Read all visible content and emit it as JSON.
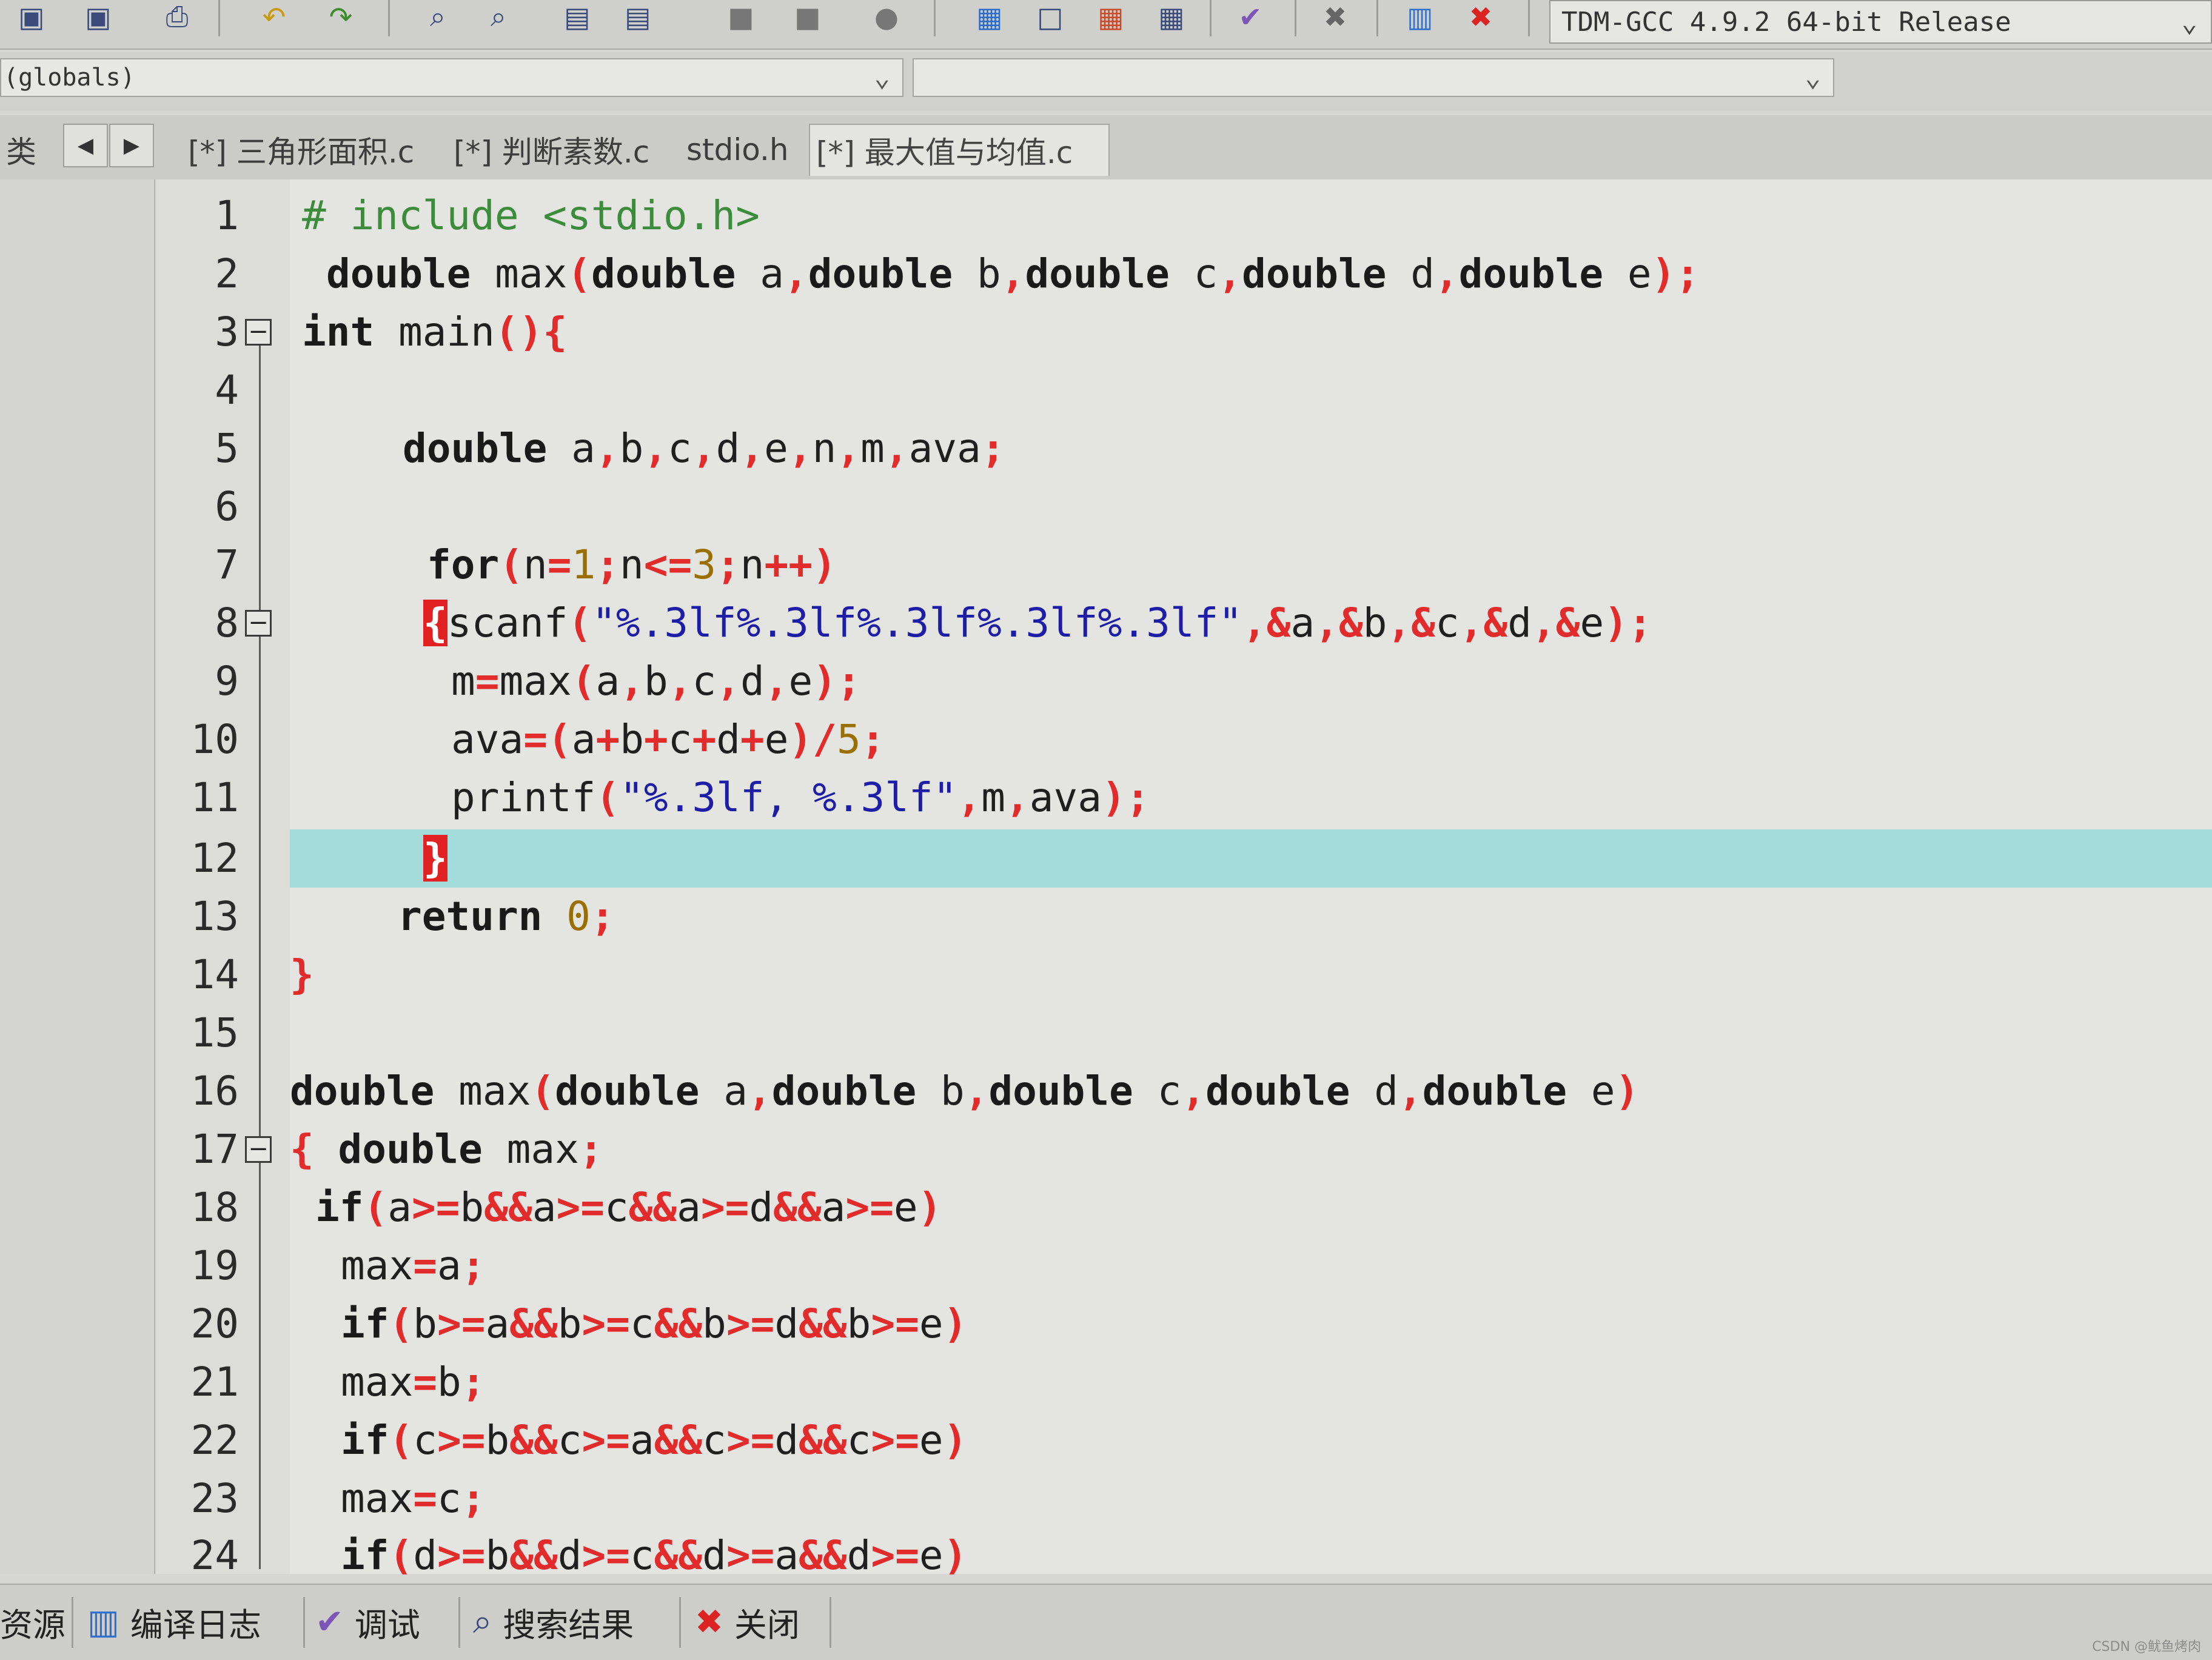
{
  "toolbar": {
    "compiler": "TDM-GCC 4.9.2 64-bit Release",
    "icons": [
      "debug-icon",
      "debug-all-icon",
      "print-icon",
      "undo-icon",
      "redo-icon",
      "find-icon",
      "replace-icon",
      "save-icon",
      "save-all-icon",
      "compile-icon",
      "run-icon",
      "stop-icon",
      "project-new-icon",
      "window-icon",
      "class-icon",
      "grid-icon",
      "check-icon",
      "close-icon",
      "chart-icon",
      "delete-icon"
    ]
  },
  "scope": {
    "left_value": "(globals)",
    "right_value": ""
  },
  "tabs": {
    "left_label": "类",
    "items": [
      {
        "label": "[*] 三角形面积.c",
        "active": false
      },
      {
        "label": "[*] 判断素数.c",
        "active": false
      },
      {
        "label": "stdio.h",
        "active": false
      },
      {
        "label": "[*] 最大值与均值.c",
        "active": true
      }
    ]
  },
  "editor": {
    "highlighted_line": 12,
    "lines": [
      {
        "n": "1"
      },
      {
        "n": "2"
      },
      {
        "n": "3"
      },
      {
        "n": "4"
      },
      {
        "n": "5"
      },
      {
        "n": "6"
      },
      {
        "n": "7"
      },
      {
        "n": "8"
      },
      {
        "n": "9"
      },
      {
        "n": "10"
      },
      {
        "n": "11"
      },
      {
        "n": "12"
      },
      {
        "n": "13"
      },
      {
        "n": "14"
      },
      {
        "n": "15"
      },
      {
        "n": "16"
      },
      {
        "n": "17"
      },
      {
        "n": "18"
      },
      {
        "n": "19"
      },
      {
        "n": "20"
      },
      {
        "n": "21"
      },
      {
        "n": "22"
      },
      {
        "n": "23"
      },
      {
        "n": "24"
      }
    ],
    "code": {
      "l1_pre": "# include <stdio.h>",
      "l2_t1": "double",
      "l2_t2": " max",
      "l2_t3": "(",
      "l2_t4": "double",
      "l2_t5": " a",
      "l2_t6": ",",
      "l2_t7": "double",
      "l2_t8": " b",
      "l2_t9": ",",
      "l2_t10": "double",
      "l2_t11": " c",
      "l2_t12": ",",
      "l2_t13": "double",
      "l2_t14": " d",
      "l2_t15": ",",
      "l2_t16": "double",
      "l2_t17": " e",
      "l2_t18": ");",
      "l3_t1": "int",
      "l3_t2": " main",
      "l3_t3": "(){",
      "l5_t1": "double",
      "l5_t2": " a",
      "l5_t3": ",",
      "l5_t4": "b",
      "l5_t5": ",",
      "l5_t6": "c",
      "l5_t7": ",",
      "l5_t8": "d",
      "l5_t9": ",",
      "l5_t10": "e",
      "l5_t11": ",",
      "l5_t12": "n",
      "l5_t13": ",",
      "l5_t14": "m",
      "l5_t15": ",",
      "l5_t16": "ava",
      "l5_t17": ";",
      "l7_t1": "for",
      "l7_t2": "(",
      "l7_t3": "n",
      "l7_t4": "=",
      "l7_t5": "1",
      "l7_t6": ";",
      "l7_t7": "n",
      "l7_t8": "<=",
      "l7_t9": "3",
      "l7_t10": ";",
      "l7_t11": "n",
      "l7_t12": "++)",
      "l8_t1": "{",
      "l8_t2": "scanf",
      "l8_t3": "(",
      "l8_t4": "\"%.3lf%.3lf%.3lf%.3lf%.3lf\"",
      "l8_t5": ",&",
      "l8_t6": "a",
      "l8_t7": ",&",
      "l8_t8": "b",
      "l8_t9": ",&",
      "l8_t10": "c",
      "l8_t11": ",&",
      "l8_t12": "d",
      "l8_t13": ",&",
      "l8_t14": "e",
      "l8_t15": ");",
      "l9_t1": "m",
      "l9_t2": "=",
      "l9_t3": "max",
      "l9_t4": "(",
      "l9_t5": "a",
      "l9_t6": ",",
      "l9_t7": "b",
      "l9_t8": ",",
      "l9_t9": "c",
      "l9_t10": ",",
      "l9_t11": "d",
      "l9_t12": ",",
      "l9_t13": "e",
      "l9_t14": ");",
      "l10_t1": "ava",
      "l10_t2": "=(",
      "l10_t3": "a",
      "l10_t4": "+",
      "l10_t5": "b",
      "l10_t6": "+",
      "l10_t7": "c",
      "l10_t8": "+",
      "l10_t9": "d",
      "l10_t10": "+",
      "l10_t11": "e",
      "l10_t12": ")/",
      "l10_t13": "5",
      "l10_t14": ";",
      "l11_t1": "printf",
      "l11_t2": "(",
      "l11_t3": "\"%.3lf, %.3lf\"",
      "l11_t4": ",",
      "l11_t5": "m",
      "l11_t6": ",",
      "l11_t7": "ava",
      "l11_t8": ");",
      "l12_t1": "}",
      "l13_t1": "return",
      "l13_t2": " 0",
      "l13_t3": ";",
      "l14_t1": "}",
      "l16_t1": "double",
      "l16_t2": " max",
      "l16_t3": "(",
      "l16_t4": "double",
      "l16_t5": " a",
      "l16_t6": ",",
      "l16_t7": "double",
      "l16_t8": " b",
      "l16_t9": ",",
      "l16_t10": "double",
      "l16_t11": " c",
      "l16_t12": ",",
      "l16_t13": "double",
      "l16_t14": " d",
      "l16_t15": ",",
      "l16_t16": "double",
      "l16_t17": " e",
      "l16_t18": ")",
      "l17_t1": "{",
      "l17_t2": " double",
      "l17_t3": " max",
      "l17_t4": ";",
      "l18_t1": "if",
      "l18_t2": "(",
      "l18_t3": "a",
      "l18_t4": ">=",
      "l18_t5": "b",
      "l18_t6": "&&",
      "l18_t7": "a",
      "l18_t8": ">=",
      "l18_t9": "c",
      "l18_t10": "&&",
      "l18_t11": "a",
      "l18_t12": ">=",
      "l18_t13": "d",
      "l18_t14": "&&",
      "l18_t15": "a",
      "l18_t16": ">=",
      "l18_t17": "e",
      "l18_t18": ")",
      "l19_t1": "max",
      "l19_t2": "=",
      "l19_t3": "a",
      "l19_t4": ";",
      "l20_t1": "if",
      "l20_t2": "(",
      "l20_t3": "b",
      "l20_t4": ">=",
      "l20_t5": "a",
      "l20_t6": "&&",
      "l20_t7": "b",
      "l20_t8": ">=",
      "l20_t9": "c",
      "l20_t10": "&&",
      "l20_t11": "b",
      "l20_t12": ">=",
      "l20_t13": "d",
      "l20_t14": "&&",
      "l20_t15": "b",
      "l20_t16": ">=",
      "l20_t17": "e",
      "l20_t18": ")",
      "l21_t1": "max",
      "l21_t2": "=",
      "l21_t3": "b",
      "l21_t4": ";",
      "l22_t1": "if",
      "l22_t2": "(",
      "l22_t3": "c",
      "l22_t4": ">=",
      "l22_t5": "b",
      "l22_t6": "&&",
      "l22_t7": "c",
      "l22_t8": ">=",
      "l22_t9": "a",
      "l22_t10": "&&",
      "l22_t11": "c",
      "l22_t12": ">=",
      "l22_t13": "d",
      "l22_t14": "&&",
      "l22_t15": "c",
      "l22_t16": ">=",
      "l22_t17": "e",
      "l22_t18": ")",
      "l23_t1": "max",
      "l23_t2": "=",
      "l23_t3": "c",
      "l23_t4": ";",
      "l24_t1": "if",
      "l24_t2": "(",
      "l24_t3": "d",
      "l24_t4": ">=",
      "l24_t5": "b",
      "l24_t6": "&&",
      "l24_t7": "d",
      "l24_t8": ">=",
      "l24_t9": "c",
      "l24_t10": "&&",
      "l24_t11": "d",
      "l24_t12": ">=",
      "l24_t13": "a",
      "l24_t14": "&&",
      "l24_t15": "d",
      "l24_t16": ">=",
      "l24_t17": "e",
      "l24_t18": ")"
    }
  },
  "bottom_tabs": {
    "resources": "资源",
    "compile_log": "编译日志",
    "debug": "调试",
    "search_results": "搜索结果",
    "close": "关闭"
  },
  "watermark": "CSDN @鱿鱼烤肉",
  "colors": {
    "keyword": "#1a1a1a",
    "symbol": "#e22b2b",
    "string": "#1d1da8",
    "preprocessor": "#3b8c3b",
    "highlight": "#8fd8d8"
  }
}
